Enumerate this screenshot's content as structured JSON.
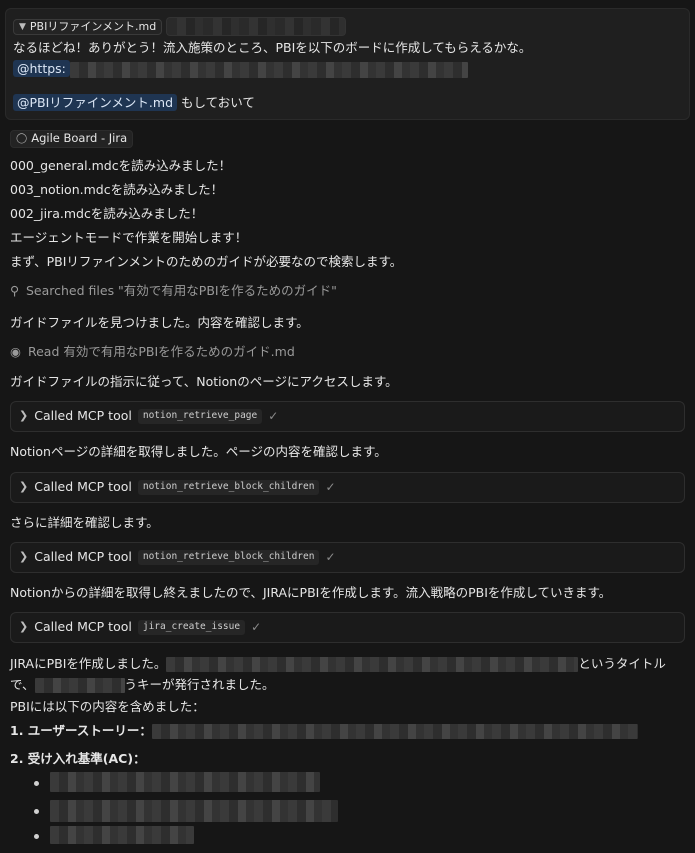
{
  "input_box": {
    "file_chip_icon": "pin-icon",
    "file_chip_label": "PBIリファインメント.md",
    "message_line1": "なるほどね！ありがとう！流入施策のところ、PBIを以下のボードに作成してもらえるかな。",
    "url_mention": "@https:",
    "file_mention": "@PBIリファインメント.md",
    "message_suffix": "もしておいて"
  },
  "context_chip": {
    "icon": "globe-icon",
    "label": "Agile Board - Jira"
  },
  "log": {
    "line1": "000_general.mdcを読み込みました！",
    "line2": "003_notion.mdcを読み込みました！",
    "line3": "002_jira.mdcを読み込みました！",
    "line4": "エージェントモードで作業を開始します！",
    "line5": "まず、PBIリファインメントのためのガイドが必要なので検索します。",
    "search_action": "Searched files \"有効で有用なPBIを作るためのガイド\"",
    "line6": "ガイドファイルを見つけました。内容を確認します。",
    "read_action": "Read 有効で有用なPBIを作るためのガイド.md",
    "line7": "ガイドファイルの指示に従って、Notionのページにアクセスします。",
    "line8": "Notionページの詳細を取得しました。ページの内容を確認します。",
    "line9": "さらに詳細を確認します。",
    "line10": "Notionからの詳細を取得し終えましたので、JIRAにPBIを作成します。流入戦略のPBIを作成していきます。",
    "line11_start": "JIRAにPBIを作成しました。",
    "line11_end": "というタイトル",
    "line12_start": "で、",
    "line12_end": "うキーが発行されました。",
    "line13": "PBIには以下の内容を含めました：",
    "item1": "1. ユーザーストーリー：",
    "item2": "2. 受け入れ基準(AC)："
  },
  "mcp_calls": [
    {
      "label": "Called MCP tool",
      "tool": "notion_retrieve_page"
    },
    {
      "label": "Called MCP tool",
      "tool": "notion_retrieve_block_children"
    },
    {
      "label": "Called MCP tool",
      "tool": "notion_retrieve_block_children"
    },
    {
      "label": "Called MCP tool",
      "tool": "jira_create_issue"
    }
  ]
}
